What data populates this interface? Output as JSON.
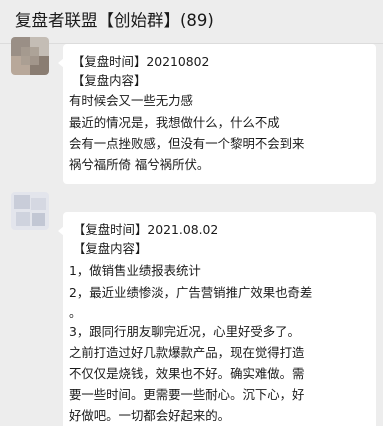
{
  "header": {
    "title": "复盘者联盟【创始群】(89)"
  },
  "messages": [
    {
      "lines": [
        "【复盘时间】20210802",
        "【复盘内容】",
        "有时候会又一些无力感",
        "最近的情况是，我想做什么，什么不成",
        "会有一点挫败感，但没有一个黎明不会到来",
        "祸兮福所倚 福兮祸所伏。"
      ]
    },
    {
      "lines": [
        "【复盘时间】2021.08.02",
        "【复盘内容】",
        "1，做销售业绩报表统计",
        "2，最近业绩惨淡，广告营销推广效果也奇差",
        "。",
        "3，跟同行朋友聊完近况，心里好受多了。",
        "之前打造过好几款爆款产品，现在觉得打造",
        "不仅仅是烧钱，效果也不好。确实难做。需",
        "要一些时间。更需要一些耐心。沉下心，好",
        "好做吧。一切都会好起来的。"
      ]
    }
  ],
  "colors": {
    "background": "#ededed",
    "bubble": "#ffffff",
    "text": "#1a1a1a"
  }
}
